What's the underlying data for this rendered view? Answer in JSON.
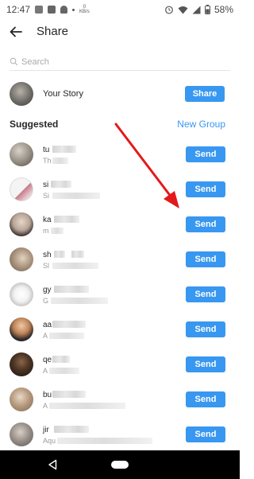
{
  "status_bar": {
    "time": "12:47",
    "speed_label": "KB/s",
    "battery_percent": "58%"
  },
  "header": {
    "title": "Share"
  },
  "search": {
    "placeholder": "Search"
  },
  "story": {
    "label": "Your Story",
    "button_label": "Share"
  },
  "suggested": {
    "title": "Suggested",
    "new_group_label": "New Group"
  },
  "contacts": [
    {
      "name_prefix": "tu",
      "sub_prefix": "Th",
      "button_label": "Send"
    },
    {
      "name_prefix": "si",
      "sub_prefix": "Si",
      "button_label": "Send"
    },
    {
      "name_prefix": "ka",
      "sub_prefix": "m",
      "button_label": "Send"
    },
    {
      "name_prefix": "sh",
      "sub_prefix": "Sl",
      "button_label": "Send"
    },
    {
      "name_prefix": "gy",
      "sub_prefix": "G",
      "button_label": "Send"
    },
    {
      "name_prefix": "aa",
      "sub_prefix": "A",
      "button_label": "Send"
    },
    {
      "name_prefix": "qe",
      "sub_prefix": "A",
      "button_label": "Send"
    },
    {
      "name_prefix": "bu",
      "sub_prefix": "A",
      "button_label": "Send"
    },
    {
      "name_prefix": "jir",
      "sub_prefix": "Aqu",
      "button_label": "Send"
    }
  ],
  "colors": {
    "accent": "#3897f0",
    "annotation_arrow": "#e3191c",
    "text_primary": "#262626",
    "text_secondary": "#999999",
    "nav_bar": "#000000"
  },
  "icons": {
    "back": "arrow-left-icon",
    "search": "search-icon",
    "nav_back": "triangle-back-icon",
    "nav_home": "pill-home-icon"
  }
}
